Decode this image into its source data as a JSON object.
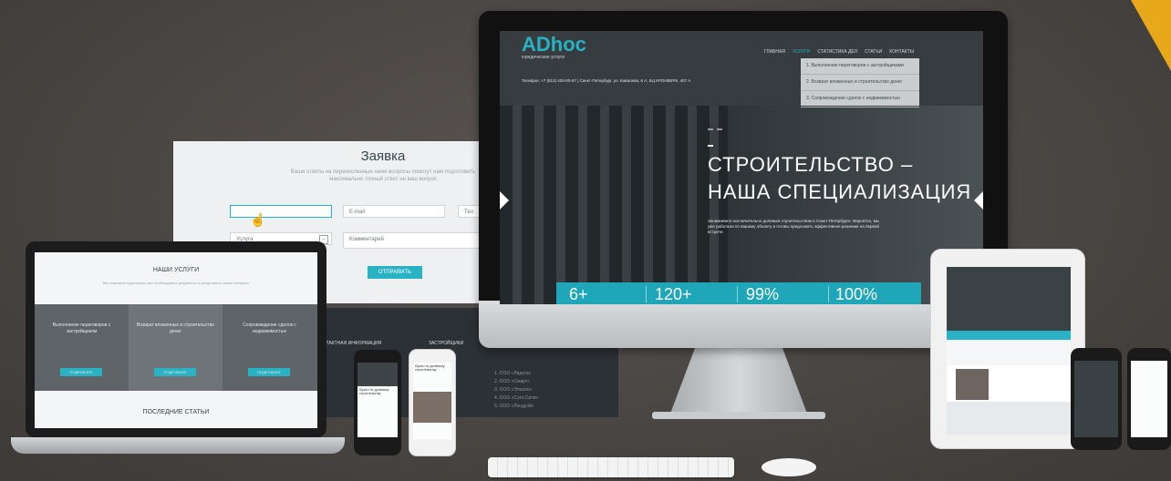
{
  "colors": {
    "accent": "#29b1c4",
    "corner": "#e7a81a",
    "background": "#4a4643"
  },
  "form": {
    "title": "Заявка",
    "subtitle": "Ваши ответы на перечисленные ниже вопросы помогут нам подготовить максимально точный ответ на ваш вопрос",
    "email_placeholder": "E-mail",
    "tel_placeholder": "Тел",
    "service_select": "Услуга",
    "comment_placeholder": "Комментарий",
    "send_label": "ОТПРАВИТЬ"
  },
  "imac": {
    "logo": "ADhoc",
    "logo_sub": "юридические услуги",
    "nav": [
      "ГЛАВНАЯ",
      "УСЛУГИ",
      "СТАТИСТИКА ДЕЛ",
      "СТАТЬИ",
      "КОНТАКТЫ"
    ],
    "contact_line": "Телефон: +7 (812) 425-80-67  |  Санкт-Петербург, ул. Кавалева, 6 А, БЦ КРОНВЕРК, 407 А",
    "dropdown": [
      "1. Выполнение переговоров с застройщиками",
      "2. Возврат вложенных в строительство денег",
      "3. Сопровождение сделок с недвижимостью"
    ],
    "hero_line1": "СТРОИТЕЛЬСТВО  –",
    "hero_line2": "НАША СПЕЦИАЛИЗАЦИЯ",
    "hero_text": "Занимаемся исключительно долевым строительством в Санкт-Петербурге. Вероятно, мы уже работали по вашему объекту и готовы предложить эффективное решение на первой встрече.",
    "stats": [
      "6+",
      "120+",
      "99%",
      "100%"
    ]
  },
  "laptop": {
    "section_title": "НАШИ УСЛУГИ",
    "section_sub": "Мы поможем подготовить все необходимые документы и представить ваши интересы",
    "services": [
      "Выполнение переговоров с застройщиком",
      "Возврат вложенных в строительство денег",
      "Сопровождение сделок с недвижимостью"
    ],
    "service_button": "ПОДРОБНЕЕ",
    "articles_title": "ПОСЛЕДНИЕ СТАТЬИ"
  },
  "footer": {
    "col1_title": "ОНТАКТНАЯ ИНФОРМАЦИЯ",
    "col2_title": "ЗАСТРОЙЩИКИ",
    "builders": [
      "1. ООО «Ладога»",
      "2. ООО «Смарт»",
      "3. ООО «Эталон»",
      "4. ООО «Сэтл Сити»",
      "5. ООО «Лэндуэй»"
    ]
  },
  "phones": {
    "p1_title": "Юрист по долевому строительству",
    "p2_title": "Юрист по долевому строительству"
  },
  "icons": [
    "cursor-hand-icon",
    "left-arrow-icon",
    "right-arrow-icon",
    "select-toggle-icon"
  ]
}
